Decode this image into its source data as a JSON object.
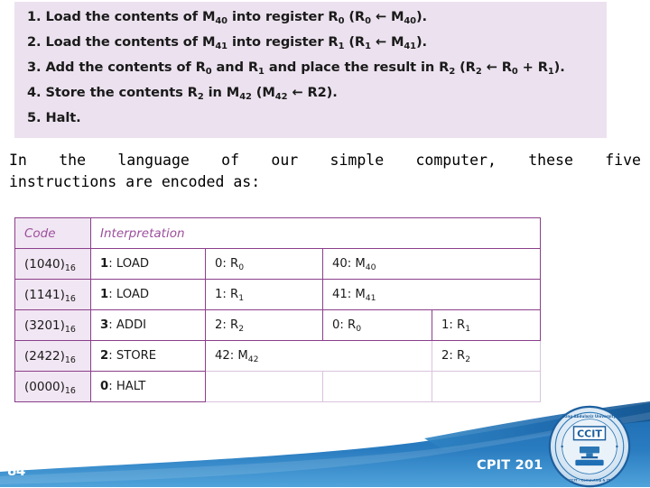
{
  "slide": {
    "page_number": "84",
    "course_code": "CPIT 201",
    "logo_name": "ccit-university-seal-logo",
    "logo_text": "CCIT",
    "accent_purple": "#8b3f8b",
    "panel_background": "#ece2ef",
    "footer_blue": "#1f6fb5"
  },
  "instructions": {
    "items": [
      {
        "id": "instruction-1",
        "segments": [
          {
            "t": "1. Load the contents of M"
          },
          {
            "t": "40",
            "sub": true
          },
          {
            "t": " into register R"
          },
          {
            "t": "0",
            "sub": true
          },
          {
            "t": " (R"
          },
          {
            "t": "0",
            "sub": true
          },
          {
            "t": " ← M"
          },
          {
            "t": "40",
            "sub": true
          },
          {
            "t": ")."
          }
        ]
      },
      {
        "id": "instruction-2",
        "segments": [
          {
            "t": "2. Load the contents of M"
          },
          {
            "t": "41",
            "sub": true
          },
          {
            "t": " into register R"
          },
          {
            "t": "1",
            "sub": true
          },
          {
            "t": " (R"
          },
          {
            "t": "1",
            "sub": true
          },
          {
            "t": " ← M"
          },
          {
            "t": "41",
            "sub": true
          },
          {
            "t": ")."
          }
        ]
      },
      {
        "id": "instruction-3",
        "segments": [
          {
            "t": "3. Add the contents of R"
          },
          {
            "t": "0",
            "sub": true
          },
          {
            "t": " and R"
          },
          {
            "t": "1",
            "sub": true
          },
          {
            "t": " and place the result in R"
          },
          {
            "t": "2",
            "sub": true
          },
          {
            "t": " (R"
          },
          {
            "t": "2",
            "sub": true
          },
          {
            "t": " ← R"
          },
          {
            "t": "0",
            "sub": true
          },
          {
            "t": " + R"
          },
          {
            "t": "1",
            "sub": true
          },
          {
            "t": ")."
          }
        ]
      },
      {
        "id": "instruction-4",
        "segments": [
          {
            "t": "4. Store the contents R"
          },
          {
            "t": "2",
            "sub": true
          },
          {
            "t": " in M"
          },
          {
            "t": "42",
            "sub": true
          },
          {
            "t": " (M"
          },
          {
            "t": "42",
            "sub": true
          },
          {
            "t": " ← R2)."
          }
        ]
      },
      {
        "id": "instruction-5",
        "segments": [
          {
            "t": "5. Halt."
          }
        ]
      }
    ]
  },
  "narrative": {
    "line1": "In the language of our simple computer, these five",
    "line2": "instructions are encoded as:"
  },
  "table": {
    "headers": {
      "code": "Code",
      "interpretation": "Interpretation"
    },
    "rows": [
      {
        "code_segments": [
          {
            "t": "(1040)"
          },
          {
            "t": "16",
            "sub": true
          }
        ],
        "cells": [
          {
            "op": "1",
            "label": ": LOAD",
            "span": 1,
            "bold_op": true
          },
          {
            "op": "0",
            "label": ": R",
            "sub": "0",
            "span": 1,
            "bold_op": false
          },
          {
            "op": "40",
            "label": ": M",
            "sub": "40",
            "span": 2,
            "bold_op": false
          }
        ]
      },
      {
        "code_segments": [
          {
            "t": "(1141)"
          },
          {
            "t": "16",
            "sub": true
          }
        ],
        "cells": [
          {
            "op": "1",
            "label": ": LOAD",
            "span": 1,
            "bold_op": true
          },
          {
            "op": "1",
            "label": ": R",
            "sub": "1",
            "span": 1,
            "bold_op": false
          },
          {
            "op": "41",
            "label": ": M",
            "sub": "41",
            "span": 2,
            "bold_op": false
          }
        ]
      },
      {
        "code_segments": [
          {
            "t": "(3201)"
          },
          {
            "t": "16",
            "sub": true
          }
        ],
        "cells": [
          {
            "op": "3",
            "label": ": ADDI",
            "span": 1,
            "bold_op": true
          },
          {
            "op": "2",
            "label": ": R",
            "sub": "2",
            "span": 1,
            "bold_op": false
          },
          {
            "op": "0",
            "label": ": R",
            "sub": "0",
            "span": 1,
            "bold_op": false
          },
          {
            "op": "1",
            "label": ": R",
            "sub": "1",
            "span": 1,
            "bold_op": false
          }
        ]
      },
      {
        "code_segments": [
          {
            "t": "(2422)"
          },
          {
            "t": "16",
            "sub": true
          }
        ],
        "cells": [
          {
            "op": "2",
            "label": ": STORE",
            "span": 1,
            "bold_op": true
          },
          {
            "op": "42",
            "label": ": M",
            "sub": "42",
            "span": 2,
            "bold_op": false
          },
          {
            "op": "2",
            "label": ": R",
            "sub": "2",
            "span": 1,
            "bold_op": false
          }
        ]
      },
      {
        "code_segments": [
          {
            "t": "(0000)"
          },
          {
            "t": "16",
            "sub": true
          }
        ],
        "cells": [
          {
            "op": "0",
            "label": ": HALT",
            "span": 1,
            "bold_op": true
          },
          {
            "op": "",
            "label": "",
            "span": 1,
            "bold_op": false
          },
          {
            "op": "",
            "label": "",
            "span": 1,
            "bold_op": false
          },
          {
            "op": "",
            "label": "",
            "span": 1,
            "bold_op": false
          }
        ]
      }
    ]
  }
}
